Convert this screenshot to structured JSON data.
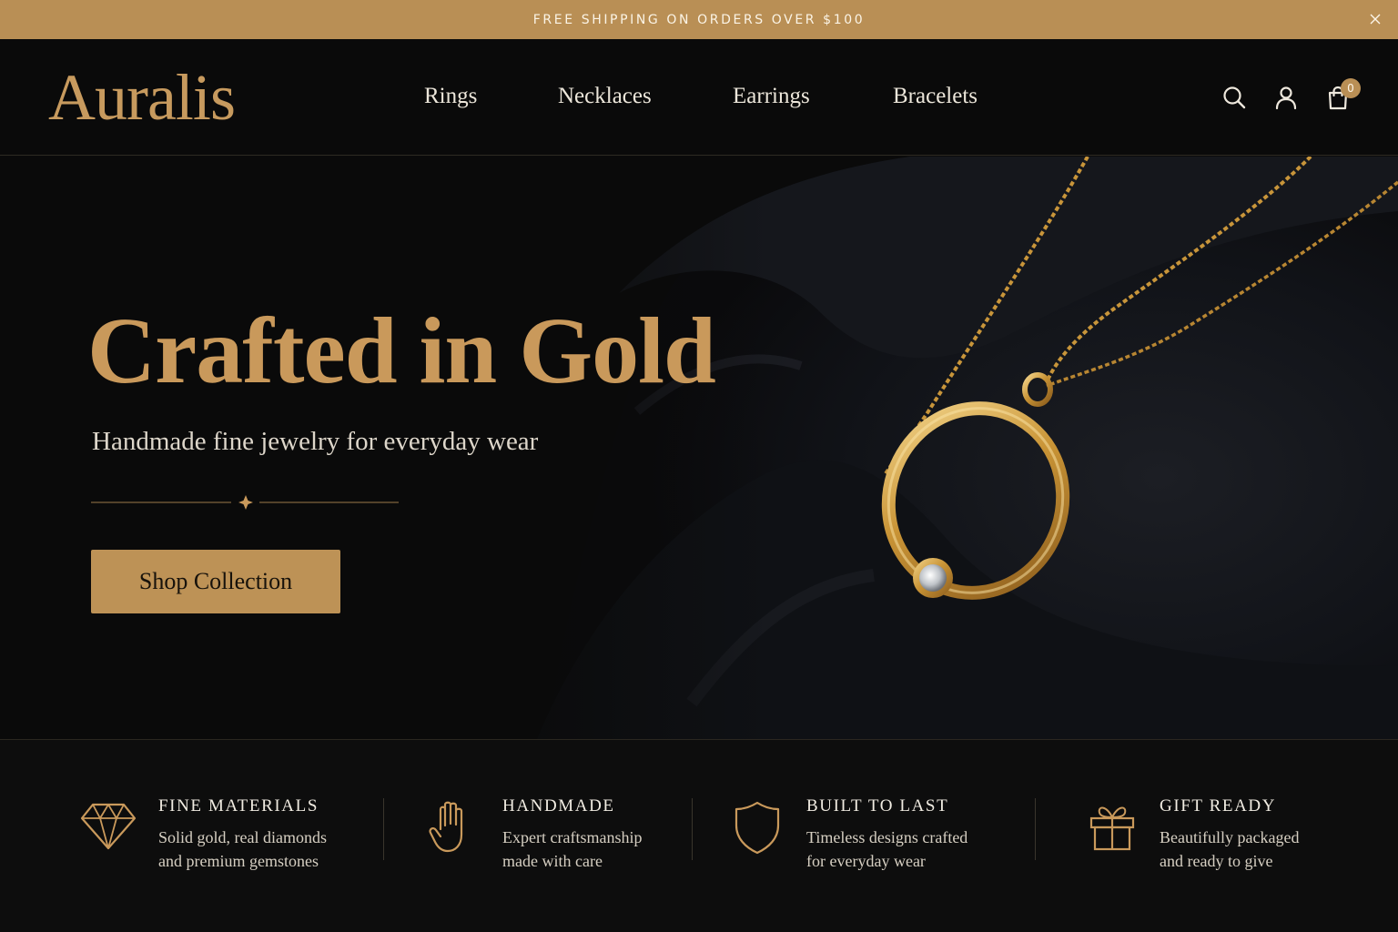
{
  "announcement": {
    "text": "FREE SHIPPING ON ORDERS OVER $100",
    "close_icon": "close-icon"
  },
  "header": {
    "logo": "Auralis",
    "nav": [
      {
        "label": "Rings"
      },
      {
        "label": "Necklaces"
      },
      {
        "label": "Earrings"
      },
      {
        "label": "Bracelets"
      }
    ],
    "icons": [
      "search-icon",
      "account-icon",
      "shopping-bag-icon"
    ],
    "cart_count": "0"
  },
  "hero": {
    "title": "Crafted in Gold",
    "subtitle": "Handmade fine jewelry for everyday wear",
    "cta_label": "Shop Collection"
  },
  "features": [
    {
      "icon": "diamond-icon",
      "title": "FINE MATERIALS",
      "line1": "Solid gold, real diamonds",
      "line2": "and premium gemstones"
    },
    {
      "icon": "hand-icon",
      "title": "HANDMADE",
      "line1": "Expert craftsmanship",
      "line2": "made with care"
    },
    {
      "icon": "shield-icon",
      "title": "BUILT TO LAST",
      "line1": "Timeless designs crafted",
      "line2": "for everyday wear"
    },
    {
      "icon": "gift-icon",
      "title": "GIFT READY",
      "line1": "Beautifully packaged",
      "line2": "and ready to give"
    }
  ],
  "colors": {
    "accent_gold": "#bd9256",
    "background": "#0b0b0b",
    "text_light": "#ece6da"
  }
}
